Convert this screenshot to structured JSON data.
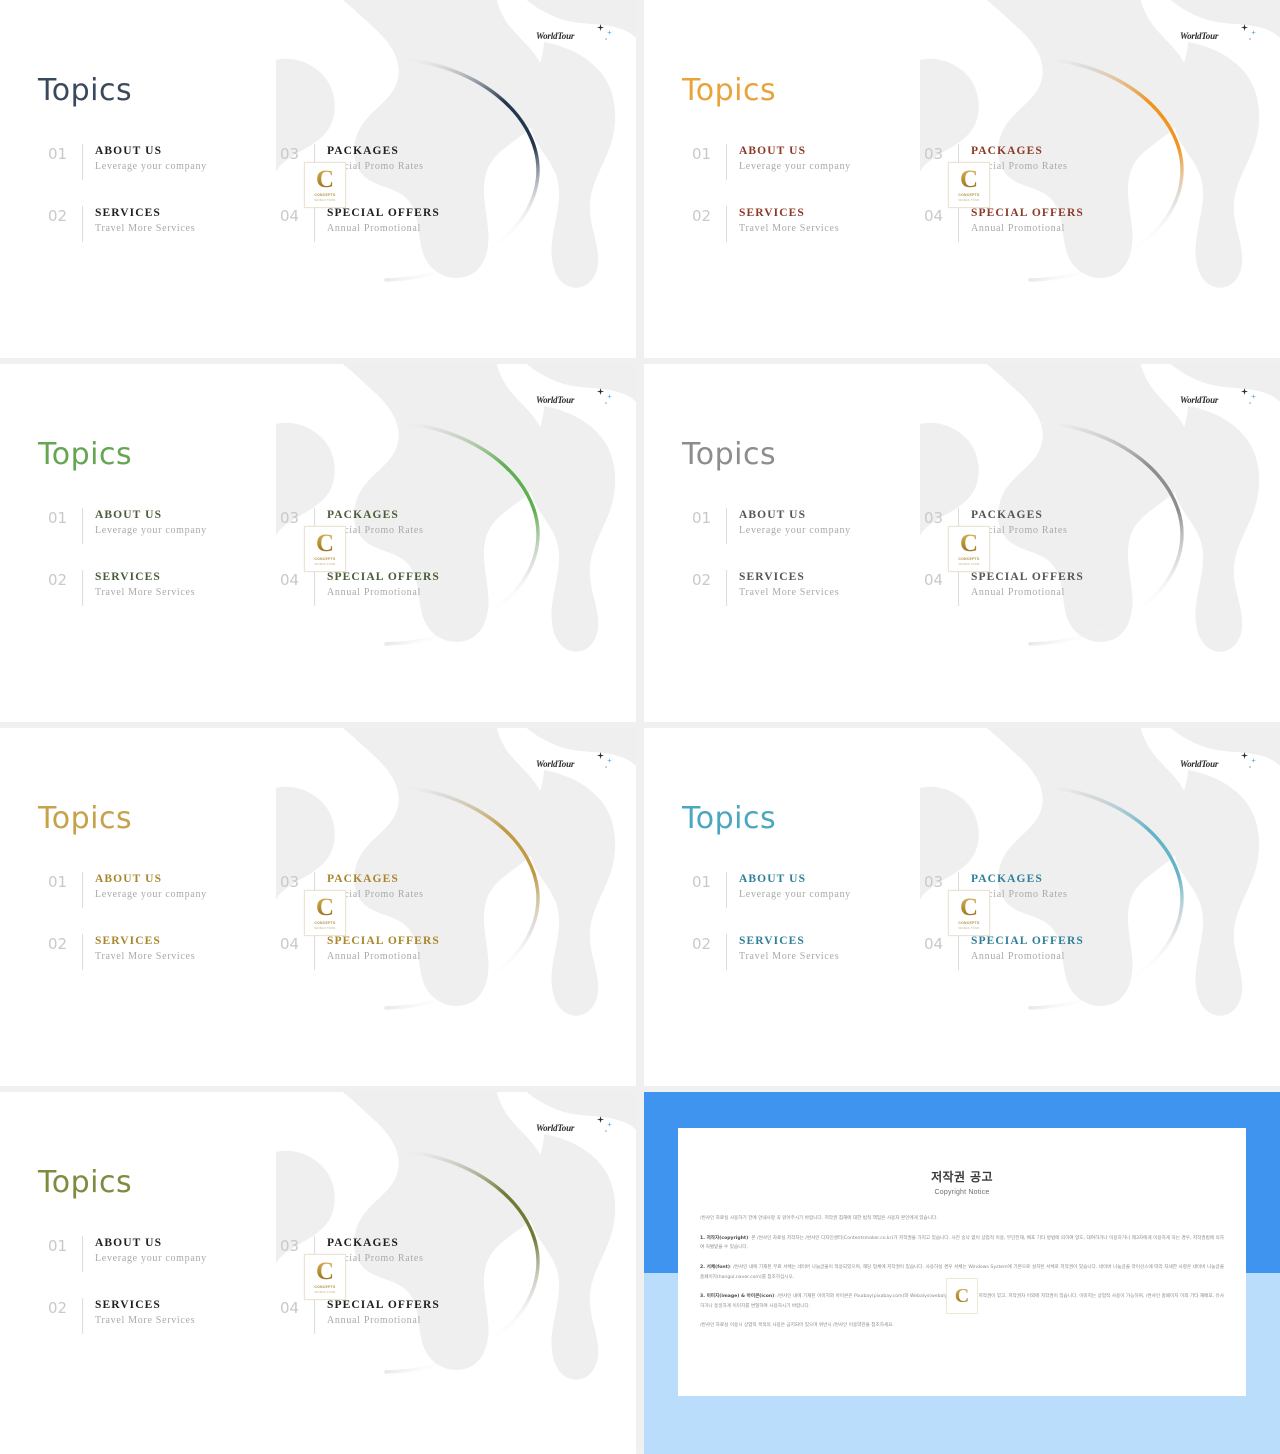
{
  "deck": {
    "logo_text": "WorldTour",
    "badge": {
      "letter": "C",
      "line1": "CONCEPTS",
      "line2": "WORLD TOUR"
    },
    "slides": [
      {
        "id": "slide-navy",
        "title": "Topics",
        "title_color": "#3a4a5c",
        "item_color": "#1f1f1f",
        "arc_color": "#24364d",
        "items": [
          {
            "num": "01",
            "title": "ABOUT US",
            "sub": "Leverage your company"
          },
          {
            "num": "03",
            "title": "PACKAGES",
            "sub": "Special Promo Rates"
          },
          {
            "num": "02",
            "title": "SERVICES",
            "sub": "Travel More Services"
          },
          {
            "num": "04",
            "title": "SPECIAL OFFERS",
            "sub": "Annual Promotional"
          }
        ]
      },
      {
        "id": "slide-orange",
        "title": "Topics",
        "title_color": "#e8a33d",
        "item_color": "#8c3a27",
        "arc_color": "#f0941f",
        "items": [
          {
            "num": "01",
            "title": "ABOUT US",
            "sub": "Leverage your company"
          },
          {
            "num": "03",
            "title": "PACKAGES",
            "sub": "Special Promo Rates"
          },
          {
            "num": "02",
            "title": "SERVICES",
            "sub": "Travel More Services"
          },
          {
            "num": "04",
            "title": "SPECIAL OFFERS",
            "sub": "Annual Promotional"
          }
        ]
      },
      {
        "id": "slide-green",
        "title": "Topics",
        "title_color": "#66a653",
        "item_color": "#4a5c3a",
        "arc_color": "#5fae4f",
        "items": [
          {
            "num": "01",
            "title": "ABOUT US",
            "sub": "Leverage your company"
          },
          {
            "num": "03",
            "title": "PACKAGES",
            "sub": "Special Promo Rates"
          },
          {
            "num": "02",
            "title": "SERVICES",
            "sub": "Travel More Services"
          },
          {
            "num": "04",
            "title": "SPECIAL OFFERS",
            "sub": "Annual Promotional"
          }
        ]
      },
      {
        "id": "slide-gray",
        "title": "Topics",
        "title_color": "#8d8d8d",
        "item_color": "#555555",
        "arc_color": "#8d8d8d",
        "items": [
          {
            "num": "01",
            "title": "ABOUT US",
            "sub": "Leverage your company"
          },
          {
            "num": "03",
            "title": "PACKAGES",
            "sub": "Special Promo Rates"
          },
          {
            "num": "02",
            "title": "SERVICES",
            "sub": "Travel More Services"
          },
          {
            "num": "04",
            "title": "SPECIAL OFFERS",
            "sub": "Annual Promotional"
          }
        ]
      },
      {
        "id": "slide-gold",
        "title": "Topics",
        "title_color": "#c6a24a",
        "item_color": "#a8862c",
        "arc_color": "#bf9a43",
        "items": [
          {
            "num": "01",
            "title": "ABOUT US",
            "sub": "Leverage your company"
          },
          {
            "num": "03",
            "title": "PACKAGES",
            "sub": "Special Promo Rates"
          },
          {
            "num": "02",
            "title": "SERVICES",
            "sub": "Travel More Services"
          },
          {
            "num": "04",
            "title": "SPECIAL OFFERS",
            "sub": "Annual Promotional"
          }
        ]
      },
      {
        "id": "slide-teal",
        "title": "Topics",
        "title_color": "#4aa7bf",
        "item_color": "#2f7f99",
        "arc_color": "#63b4c9",
        "items": [
          {
            "num": "01",
            "title": "ABOUT US",
            "sub": "Leverage your company"
          },
          {
            "num": "03",
            "title": "PACKAGES",
            "sub": "Special Promo Rates"
          },
          {
            "num": "02",
            "title": "SERVICES",
            "sub": "Travel More Services"
          },
          {
            "num": "04",
            "title": "SPECIAL OFFERS",
            "sub": "Annual Promotional"
          }
        ]
      },
      {
        "id": "slide-olive",
        "title": "Topics",
        "title_color": "#7d8c3e",
        "item_color": "#1f1f1f",
        "arc_color": "#6f7a35",
        "items": [
          {
            "num": "01",
            "title": "ABOUT US",
            "sub": "Leverage your company"
          },
          {
            "num": "03",
            "title": "PACKAGES",
            "sub": "Special Promo Rates"
          },
          {
            "num": "02",
            "title": "SERVICES",
            "sub": "Travel More Services"
          },
          {
            "num": "04",
            "title": "SPECIAL OFFERS",
            "sub": "Annual Promotional"
          }
        ]
      }
    ]
  },
  "copyright": {
    "frame_color_top": "#3f94f0",
    "frame_color_bottom": "#b9ddfa",
    "heading_ko": "저작권 공고",
    "heading_en": "Copyright Notice",
    "intro": "/썬샤인 자료실 사용하기 전에 안내사항 꼭 읽어주시기 바랍니다. 저작권 침해에 대한 법적 책임은 사용자 본인에게 있습니다.",
    "sections": [
      {
        "label": "1. 저작자(copyright)",
        "text": ": 본 /썬샤인 자료실 저작자는 /썬샤인 디자인센터(Contentsmaker.co.kr)가 저작권을 가지고 있습니다. 사전 승낙 없이 상업적 이용, 무단전재, 배포 기타 방법에 의하여 양도, 대여하거나 이용하거나 제3자에게 이용하게 하는 경우, 저작권법에 의하여 처벌받을 수 있습니다."
      },
      {
        "label": "2. 서체(font)",
        "text": ": /썬샤인 내에 기재된 무료 서체는 네이버 나눔글꼴이 적용되었으며, 해당 업체에 저작권이 있습니다. 사용하실 경우 서체는 Windows System에 기본으로 설치된 서체로 저작권이 있습니다. 네이버 나눔글꼴 라이선스에 따라 자세한 사항은 네이버 나눔글꼴 홈페이지(hangul.naver.com)를 참조하십시오."
      },
      {
        "label": "3. 이미지(image) & 아이콘(icon)",
        "text": ": /썬샤인 내에 기재된 이미지와 아이콘은 Pixabay(pixabay.com)와 Webalys(webalys.com) 업체에 저작권이 있고, 저작권자 이외에 저작권이 있습니다. 이미지는 상업적 사용이 가능하며, /썬샤인 홈페이지 이외 기타 재배포, 유사하거나 동일하게 이미지를 변형하여 사용하시기 바랍니다."
      }
    ],
    "outro": "/썬샤인 자료실 이용시 상업적 목적의 사용은 금지되어 있으며 위반시 /썬샤인 이용약관을 참조하세요."
  }
}
